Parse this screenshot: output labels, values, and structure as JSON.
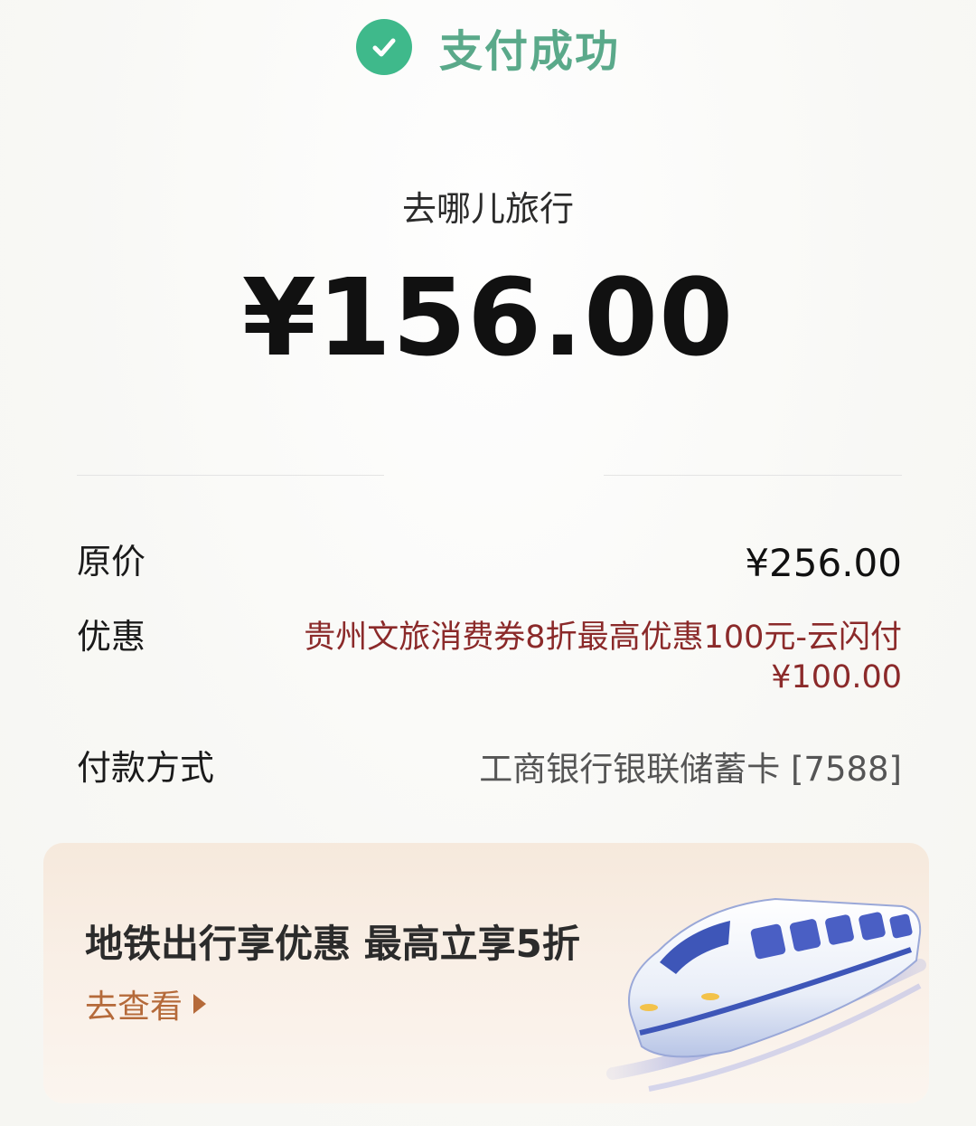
{
  "header": {
    "status_text": "支付成功",
    "status_icon": "check-circle-icon",
    "accent_color": "#3fb98b",
    "status_text_color": "#5aa98a"
  },
  "merchant": {
    "name": "去哪儿旅行"
  },
  "payment": {
    "amount": "¥156.00"
  },
  "details": {
    "original_price_label": "原价",
    "original_price_value": "¥256.00",
    "discount_label": "优惠",
    "discount_desc": "贵州文旅消费券8折最高优惠100元-云闪付",
    "discount_amount": "¥100.00",
    "discount_color": "#8b2a2a",
    "method_label": "付款方式",
    "method_value": "工商银行银联储蓄卡 [7588]"
  },
  "banner": {
    "title": "地铁出行享优惠  最高立享5折",
    "link_text": "去查看",
    "link_color": "#b56a3a",
    "icons": [
      "arrow-right-icon",
      "high-speed-train-icon"
    ]
  }
}
